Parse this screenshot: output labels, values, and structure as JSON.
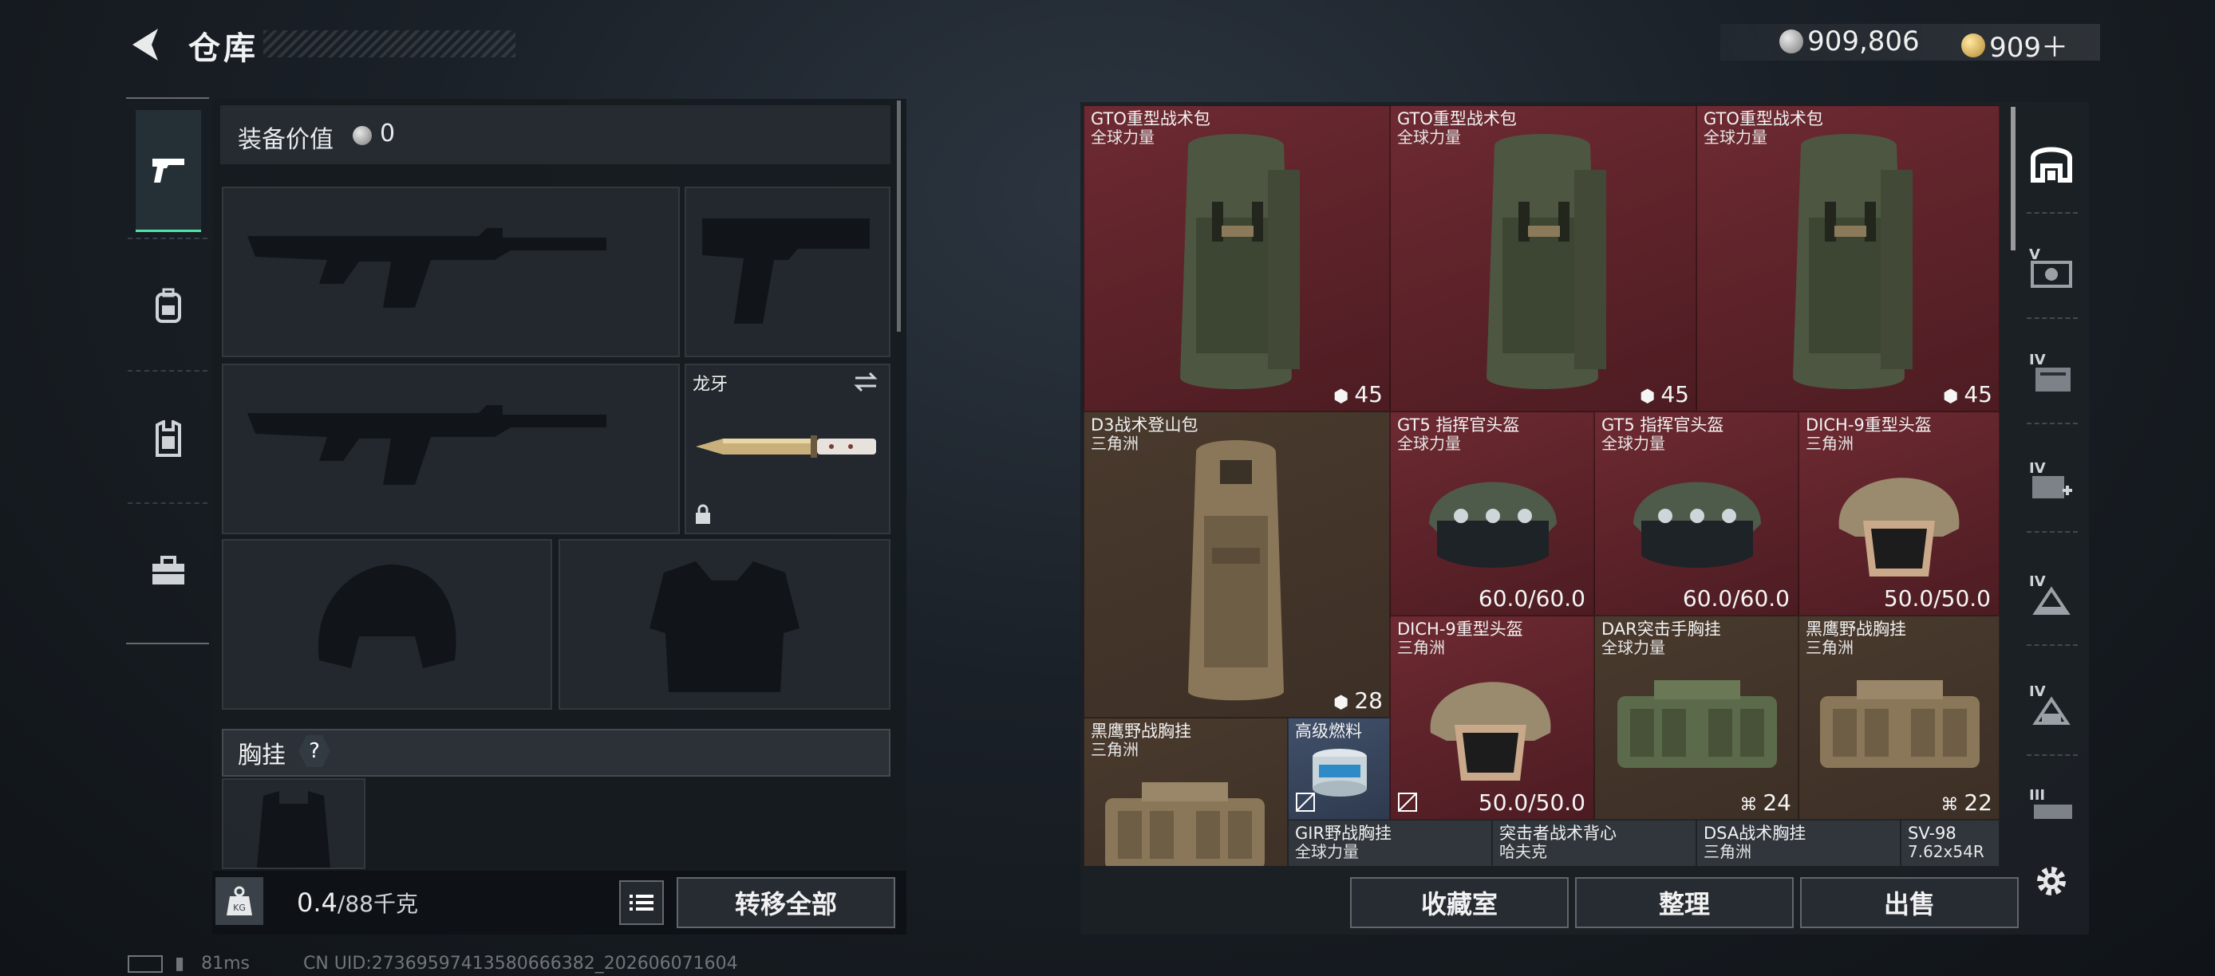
{
  "header": {
    "title": "仓库",
    "currency_silver": "909,806",
    "currency_gold": "909＋"
  },
  "left_tabs": [
    {
      "name": "weapons-tab",
      "icon": "pistol-icon",
      "active": true
    },
    {
      "name": "armor-tab",
      "icon": "backpack-icon",
      "active": false
    },
    {
      "name": "vest-tab",
      "icon": "vest-icon",
      "active": false
    },
    {
      "name": "briefcase-tab",
      "icon": "briefcase-icon",
      "active": false
    }
  ],
  "equipment": {
    "value_label": "装备价值",
    "value": "0",
    "melee_name": "龙牙",
    "chest_label": "胸挂",
    "help": "?",
    "weight_current": "0.4",
    "weight_max": "/88千克",
    "transfer_all": "转移全部"
  },
  "stash": {
    "items": [
      {
        "name": "GTO重型战术包",
        "sub": "全球力量",
        "count": "45",
        "color": "red"
      },
      {
        "name": "GTO重型战术包",
        "sub": "全球力量",
        "count": "45",
        "color": "red"
      },
      {
        "name": "GTO重型战术包",
        "sub": "全球力量",
        "count": "45",
        "color": "red"
      },
      {
        "name": "D3战术登山包",
        "sub": "三角洲",
        "count": "28",
        "color": "brown"
      },
      {
        "name": "GT5 指挥官头盔",
        "sub": "全球力量",
        "durability": "60.0/60.0",
        "color": "red"
      },
      {
        "name": "GT5 指挥官头盔",
        "sub": "全球力量",
        "durability": "60.0/60.0",
        "color": "red"
      },
      {
        "name": "DICH-9重型头盔",
        "sub": "三角洲",
        "durability": "50.0/50.0",
        "color": "red"
      },
      {
        "name": "DICH-9重型头盔",
        "sub": "三角洲",
        "durability": "50.0/50.0",
        "color": "red"
      },
      {
        "name": "DAR突击手胸挂",
        "sub": "全球力量",
        "count": "24",
        "color": "brown"
      },
      {
        "name": "黑鹰野战胸挂",
        "sub": "三角洲",
        "count": "22",
        "color": "brown"
      },
      {
        "name": "黑鹰野战胸挂",
        "sub": "三角洲",
        "color": "brown"
      },
      {
        "name": "高级燃料",
        "sub": "",
        "color": "blue"
      },
      {
        "name": "GIR野战胸挂",
        "sub": "全球力量",
        "color": "dark"
      },
      {
        "name": "突击者战术背心",
        "sub": "哈夫克",
        "color": "dark"
      },
      {
        "name": "DSA战术胸挂",
        "sub": "三角洲",
        "color": "dark"
      },
      {
        "name": "SV-98",
        "sub": "7.62x54R",
        "color": "dark"
      }
    ],
    "buttons": {
      "collection": "收藏室",
      "organize": "整理",
      "sell": "出售"
    }
  },
  "right_tabs": [
    {
      "name": "stash-overview-tab",
      "label": ""
    },
    {
      "name": "stash-page-v",
      "label": "V"
    },
    {
      "name": "stash-page-iv-a",
      "label": "IV"
    },
    {
      "name": "stash-page-iv-b",
      "label": "IV"
    },
    {
      "name": "stash-page-iv-c",
      "label": "IV"
    },
    {
      "name": "stash-page-iv-d",
      "label": "IV"
    },
    {
      "name": "stash-page-iii",
      "label": "III"
    }
  ],
  "status": {
    "ping": "81ms",
    "uid": "CN UID:2736959741358066638​2_202606071604"
  }
}
